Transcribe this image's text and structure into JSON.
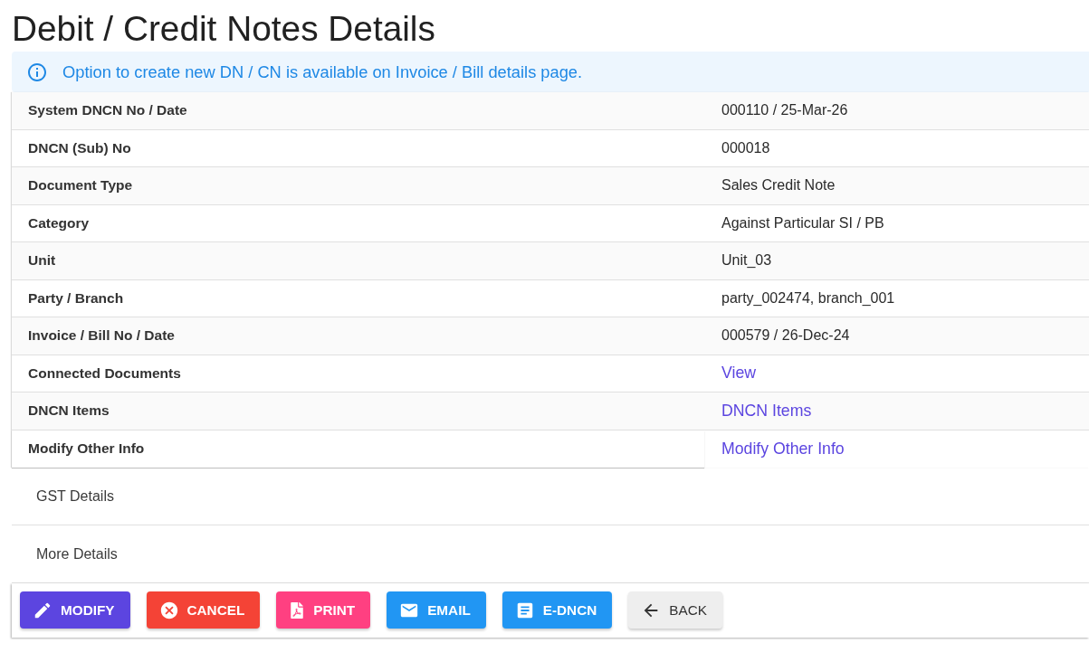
{
  "page": {
    "title": "Debit / Credit Notes Details"
  },
  "alert": {
    "text": "Option to create new DN / CN is available on Invoice / Bill details page."
  },
  "details": [
    {
      "label": "System DNCN No / Date",
      "kind": "text",
      "value": "000110 / 25-Mar-26"
    },
    {
      "label": "DNCN (Sub) No",
      "kind": "text",
      "value": "000018"
    },
    {
      "label": "Document Type",
      "kind": "text",
      "value": "Sales Credit Note"
    },
    {
      "label": "Category",
      "kind": "text",
      "value": "Against Particular SI / PB"
    },
    {
      "label": "Unit",
      "kind": "text",
      "value": "Unit_03"
    },
    {
      "label": "Party / Branch",
      "kind": "text",
      "value": "party_002474, branch_001"
    },
    {
      "label": "Invoice / Bill No / Date",
      "kind": "text",
      "value": "000579 / 26-Dec-24"
    },
    {
      "label": "Connected Documents",
      "kind": "link",
      "value": "View"
    },
    {
      "label": "DNCN Items",
      "kind": "link",
      "value": "DNCN Items"
    },
    {
      "label": "Modify Other Info",
      "kind": "link",
      "value": "Modify Other Info"
    }
  ],
  "sections": [
    {
      "title": "GST Details"
    },
    {
      "title": "More Details"
    }
  ],
  "actions": [
    {
      "label": "MODIFY",
      "kind": "edit",
      "color": "#5c45e0"
    },
    {
      "label": "CANCEL",
      "kind": "cancel",
      "color": "#f44336"
    },
    {
      "label": "PRINT",
      "kind": "pdf",
      "color": "#ff4081"
    },
    {
      "label": "EMAIL",
      "kind": "email",
      "color": "#2196f3"
    },
    {
      "label": "E-DNCN",
      "kind": "document",
      "color": "#2196f3"
    },
    {
      "label": "BACK",
      "kind": "back",
      "color": "#eeeeee"
    }
  ]
}
